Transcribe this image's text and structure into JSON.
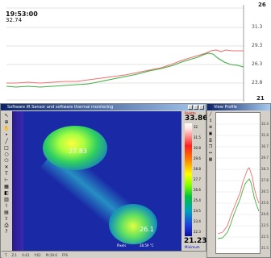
{
  "trend": {
    "time": "19:53:00",
    "value": "32.74",
    "y_top": "26",
    "y_ticks": [
      "31.3",
      "29.3",
      "26.3",
      "23.8"
    ],
    "y_bottom": "21"
  },
  "main_window": {
    "title": "Software IR Sensor and software thermal monitoring",
    "toolbar_icons": [
      "arrow-icon",
      "zoom-icon",
      "hand-icon",
      "spot-icon",
      "line-icon",
      "rect-icon",
      "circle-icon",
      "poly-icon",
      "cross-icon",
      "text-icon",
      "ruler-icon",
      "grid-icon",
      "palette-icon",
      "histogram-icon",
      "profile-icon",
      "table-icon",
      "export-icon",
      "print-icon",
      "help-icon"
    ],
    "toolbar_glyphs": [
      "↖",
      "⊕",
      "✋",
      "•",
      "╱",
      "□",
      "○",
      "⬠",
      "✕",
      "T",
      "⊢",
      "▦",
      "◧",
      "▥",
      "⌇",
      "▤",
      "⇪",
      "⎙",
      "?"
    ],
    "spot_labels": [
      "27.83",
      "26.1"
    ],
    "readout_a": "Pixels",
    "readout_b": "28.59 °C",
    "palette": {
      "header": "Palette",
      "max": "33.86",
      "ticks": [
        "32",
        "31.5",
        "30.8",
        "29.6",
        "28.8",
        "27.7",
        "26.6",
        "25.4",
        "24.5",
        "23.4",
        "22.3"
      ],
      "min": "21.23",
      "footer": "Minimum"
    },
    "status_items": [
      "T",
      "Z:1",
      "X:43",
      "Y:62",
      "Pt:29.6",
      "FPS"
    ]
  },
  "profile_window": {
    "title": "View Profile",
    "tools": [
      "line-icon",
      "cursor-icon",
      "zoom-icon",
      "save-icon",
      "print-icon",
      "copy-icon",
      "scale-icon",
      "legend-icon"
    ],
    "tool_glyphs": [
      "╱",
      "↕",
      "⊕",
      "▣",
      "⎙",
      "❐",
      "↔",
      "▦"
    ],
    "y_ticks": [
      "32.4",
      "31.8",
      "30.7",
      "29.7",
      "28.3",
      "27.8",
      "26.5",
      "25.6",
      "24.6",
      "23.5",
      "22.5",
      "21.5"
    ]
  },
  "colors": {
    "red_series": "#f07070",
    "green_series": "#40b040",
    "thermal_background": "#1a2aa6"
  }
}
